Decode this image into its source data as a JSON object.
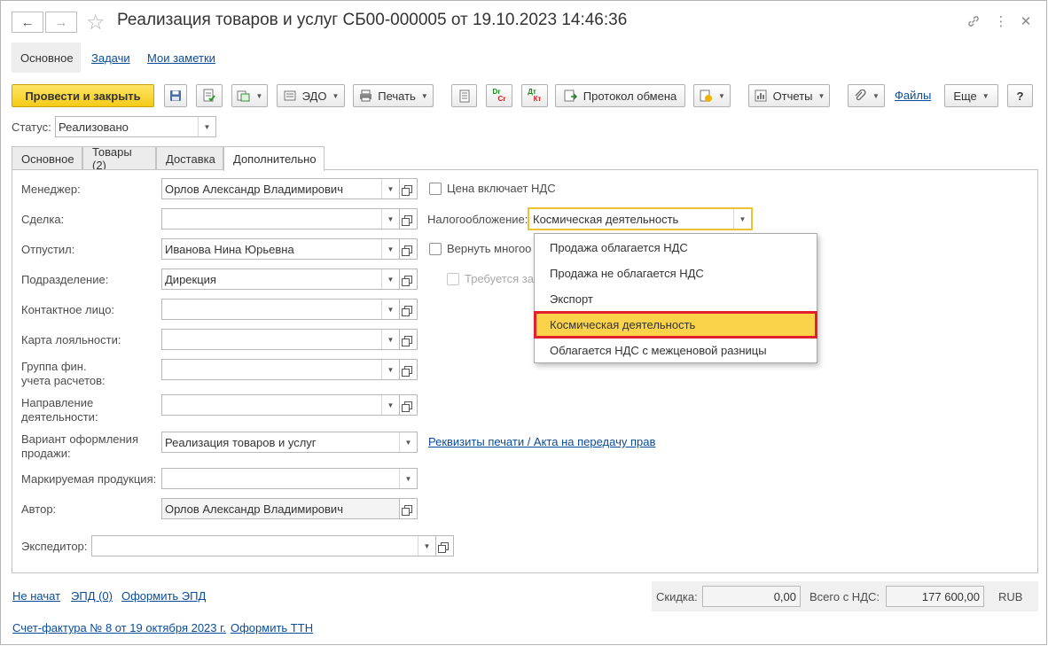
{
  "window": {
    "title": "Реализация товаров и услуг СБ00-000005 от 19.10.2023 14:46:36"
  },
  "nav": {
    "tabs": [
      "Основное",
      "Задачи",
      "Мои заметки"
    ]
  },
  "toolbar": {
    "post_close": "Провести и закрыть",
    "edo": "ЭДО",
    "print": "Печать",
    "dt_label_top": "Dr",
    "dt_label_bottom": "Cr",
    "dk_label_top": "Дт",
    "dk_label_bottom": "Кт",
    "exchange_protocol": "Протокол обмена",
    "reports": "Отчеты",
    "files": "Файлы",
    "more": "Еще",
    "help": "?"
  },
  "status": {
    "label": "Статус:",
    "value": "Реализовано"
  },
  "tabs": [
    "Основное",
    "Товары (2)",
    "Доставка",
    "Дополнительно"
  ],
  "form": {
    "manager": {
      "label": "Менеджер:",
      "value": "Орлов Александр Владимирович"
    },
    "deal": {
      "label": "Сделка:",
      "value": ""
    },
    "released": {
      "label": "Отпустил:",
      "value": "Иванова Нина Юрьевна"
    },
    "department": {
      "label": "Подразделение:",
      "value": "Дирекция"
    },
    "contact": {
      "label": "Контактное лицо:",
      "value": ""
    },
    "loyalty": {
      "label": "Карта лояльности:",
      "value": ""
    },
    "fin_group": {
      "label_1": "Группа фин.",
      "label_2": "учета расчетов:",
      "value": ""
    },
    "direction": {
      "label_1": "Направление",
      "label_2": "деятельности:",
      "value": ""
    },
    "sale_variant": {
      "label_1": "Вариант оформления",
      "label_2": "продажи:",
      "value": "Реализация товаров и услуг"
    },
    "marked": {
      "label": "Маркируемая продукция:",
      "value": ""
    },
    "author": {
      "label": "Автор:",
      "value": "Орлов Александр Владимирович"
    },
    "forwarder": {
      "label": "Экспедитор:",
      "value": ""
    },
    "price_incl_vat": "Цена включает НДС",
    "taxation": {
      "label": "Налогообложение:",
      "value": "Космическая деятельность"
    },
    "return_tara": "Вернуть многоо",
    "required": "Требуется за",
    "print_requisites": "Реквизиты печати / Акта на передачу прав"
  },
  "dropdown": {
    "options": [
      "Продажа облагается НДС",
      "Продажа не облагается НДС",
      "Экспорт",
      "Космическая деятельность",
      "Облагается НДС с межценовой разницы"
    ],
    "selected_index": 3
  },
  "footer": {
    "not_started": "Не начат",
    "epd": "ЭПД (0)",
    "make_epd": "Оформить ЭПД",
    "discount_label": "Скидка:",
    "discount_value": "0,00",
    "total_label": "Всего с НДС:",
    "total_value": "177 600,00",
    "currency": "RUB",
    "invoice": "Счет-фактура № 8 от 19 октября 2023 г.",
    "make_ttn": "Оформить ТТН"
  },
  "colors": {
    "primary_button": "#f5cb17",
    "selected_option": "#fbd34a",
    "highlight_border": "#e0202a",
    "link": "#0a4c9b"
  }
}
